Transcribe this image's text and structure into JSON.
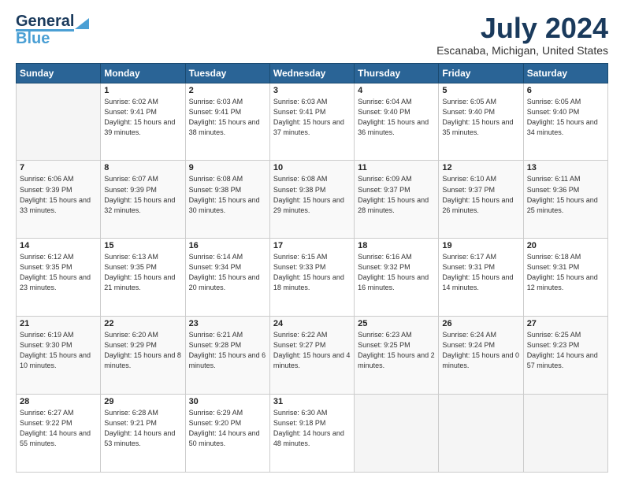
{
  "header": {
    "logo_line1": "General",
    "logo_line2": "Blue",
    "month": "July 2024",
    "location": "Escanaba, Michigan, United States"
  },
  "weekdays": [
    "Sunday",
    "Monday",
    "Tuesday",
    "Wednesday",
    "Thursday",
    "Friday",
    "Saturday"
  ],
  "weeks": [
    [
      {
        "day": "",
        "sunrise": "",
        "sunset": "",
        "daylight": ""
      },
      {
        "day": "1",
        "sunrise": "Sunrise: 6:02 AM",
        "sunset": "Sunset: 9:41 PM",
        "daylight": "Daylight: 15 hours and 39 minutes."
      },
      {
        "day": "2",
        "sunrise": "Sunrise: 6:03 AM",
        "sunset": "Sunset: 9:41 PM",
        "daylight": "Daylight: 15 hours and 38 minutes."
      },
      {
        "day": "3",
        "sunrise": "Sunrise: 6:03 AM",
        "sunset": "Sunset: 9:41 PM",
        "daylight": "Daylight: 15 hours and 37 minutes."
      },
      {
        "day": "4",
        "sunrise": "Sunrise: 6:04 AM",
        "sunset": "Sunset: 9:40 PM",
        "daylight": "Daylight: 15 hours and 36 minutes."
      },
      {
        "day": "5",
        "sunrise": "Sunrise: 6:05 AM",
        "sunset": "Sunset: 9:40 PM",
        "daylight": "Daylight: 15 hours and 35 minutes."
      },
      {
        "day": "6",
        "sunrise": "Sunrise: 6:05 AM",
        "sunset": "Sunset: 9:40 PM",
        "daylight": "Daylight: 15 hours and 34 minutes."
      }
    ],
    [
      {
        "day": "7",
        "sunrise": "Sunrise: 6:06 AM",
        "sunset": "Sunset: 9:39 PM",
        "daylight": "Daylight: 15 hours and 33 minutes."
      },
      {
        "day": "8",
        "sunrise": "Sunrise: 6:07 AM",
        "sunset": "Sunset: 9:39 PM",
        "daylight": "Daylight: 15 hours and 32 minutes."
      },
      {
        "day": "9",
        "sunrise": "Sunrise: 6:08 AM",
        "sunset": "Sunset: 9:38 PM",
        "daylight": "Daylight: 15 hours and 30 minutes."
      },
      {
        "day": "10",
        "sunrise": "Sunrise: 6:08 AM",
        "sunset": "Sunset: 9:38 PM",
        "daylight": "Daylight: 15 hours and 29 minutes."
      },
      {
        "day": "11",
        "sunrise": "Sunrise: 6:09 AM",
        "sunset": "Sunset: 9:37 PM",
        "daylight": "Daylight: 15 hours and 28 minutes."
      },
      {
        "day": "12",
        "sunrise": "Sunrise: 6:10 AM",
        "sunset": "Sunset: 9:37 PM",
        "daylight": "Daylight: 15 hours and 26 minutes."
      },
      {
        "day": "13",
        "sunrise": "Sunrise: 6:11 AM",
        "sunset": "Sunset: 9:36 PM",
        "daylight": "Daylight: 15 hours and 25 minutes."
      }
    ],
    [
      {
        "day": "14",
        "sunrise": "Sunrise: 6:12 AM",
        "sunset": "Sunset: 9:35 PM",
        "daylight": "Daylight: 15 hours and 23 minutes."
      },
      {
        "day": "15",
        "sunrise": "Sunrise: 6:13 AM",
        "sunset": "Sunset: 9:35 PM",
        "daylight": "Daylight: 15 hours and 21 minutes."
      },
      {
        "day": "16",
        "sunrise": "Sunrise: 6:14 AM",
        "sunset": "Sunset: 9:34 PM",
        "daylight": "Daylight: 15 hours and 20 minutes."
      },
      {
        "day": "17",
        "sunrise": "Sunrise: 6:15 AM",
        "sunset": "Sunset: 9:33 PM",
        "daylight": "Daylight: 15 hours and 18 minutes."
      },
      {
        "day": "18",
        "sunrise": "Sunrise: 6:16 AM",
        "sunset": "Sunset: 9:32 PM",
        "daylight": "Daylight: 15 hours and 16 minutes."
      },
      {
        "day": "19",
        "sunrise": "Sunrise: 6:17 AM",
        "sunset": "Sunset: 9:31 PM",
        "daylight": "Daylight: 15 hours and 14 minutes."
      },
      {
        "day": "20",
        "sunrise": "Sunrise: 6:18 AM",
        "sunset": "Sunset: 9:31 PM",
        "daylight": "Daylight: 15 hours and 12 minutes."
      }
    ],
    [
      {
        "day": "21",
        "sunrise": "Sunrise: 6:19 AM",
        "sunset": "Sunset: 9:30 PM",
        "daylight": "Daylight: 15 hours and 10 minutes."
      },
      {
        "day": "22",
        "sunrise": "Sunrise: 6:20 AM",
        "sunset": "Sunset: 9:29 PM",
        "daylight": "Daylight: 15 hours and 8 minutes."
      },
      {
        "day": "23",
        "sunrise": "Sunrise: 6:21 AM",
        "sunset": "Sunset: 9:28 PM",
        "daylight": "Daylight: 15 hours and 6 minutes."
      },
      {
        "day": "24",
        "sunrise": "Sunrise: 6:22 AM",
        "sunset": "Sunset: 9:27 PM",
        "daylight": "Daylight: 15 hours and 4 minutes."
      },
      {
        "day": "25",
        "sunrise": "Sunrise: 6:23 AM",
        "sunset": "Sunset: 9:25 PM",
        "daylight": "Daylight: 15 hours and 2 minutes."
      },
      {
        "day": "26",
        "sunrise": "Sunrise: 6:24 AM",
        "sunset": "Sunset: 9:24 PM",
        "daylight": "Daylight: 15 hours and 0 minutes."
      },
      {
        "day": "27",
        "sunrise": "Sunrise: 6:25 AM",
        "sunset": "Sunset: 9:23 PM",
        "daylight": "Daylight: 14 hours and 57 minutes."
      }
    ],
    [
      {
        "day": "28",
        "sunrise": "Sunrise: 6:27 AM",
        "sunset": "Sunset: 9:22 PM",
        "daylight": "Daylight: 14 hours and 55 minutes."
      },
      {
        "day": "29",
        "sunrise": "Sunrise: 6:28 AM",
        "sunset": "Sunset: 9:21 PM",
        "daylight": "Daylight: 14 hours and 53 minutes."
      },
      {
        "day": "30",
        "sunrise": "Sunrise: 6:29 AM",
        "sunset": "Sunset: 9:20 PM",
        "daylight": "Daylight: 14 hours and 50 minutes."
      },
      {
        "day": "31",
        "sunrise": "Sunrise: 6:30 AM",
        "sunset": "Sunset: 9:18 PM",
        "daylight": "Daylight: 14 hours and 48 minutes."
      },
      {
        "day": "",
        "sunrise": "",
        "sunset": "",
        "daylight": ""
      },
      {
        "day": "",
        "sunrise": "",
        "sunset": "",
        "daylight": ""
      },
      {
        "day": "",
        "sunrise": "",
        "sunset": "",
        "daylight": ""
      }
    ]
  ]
}
